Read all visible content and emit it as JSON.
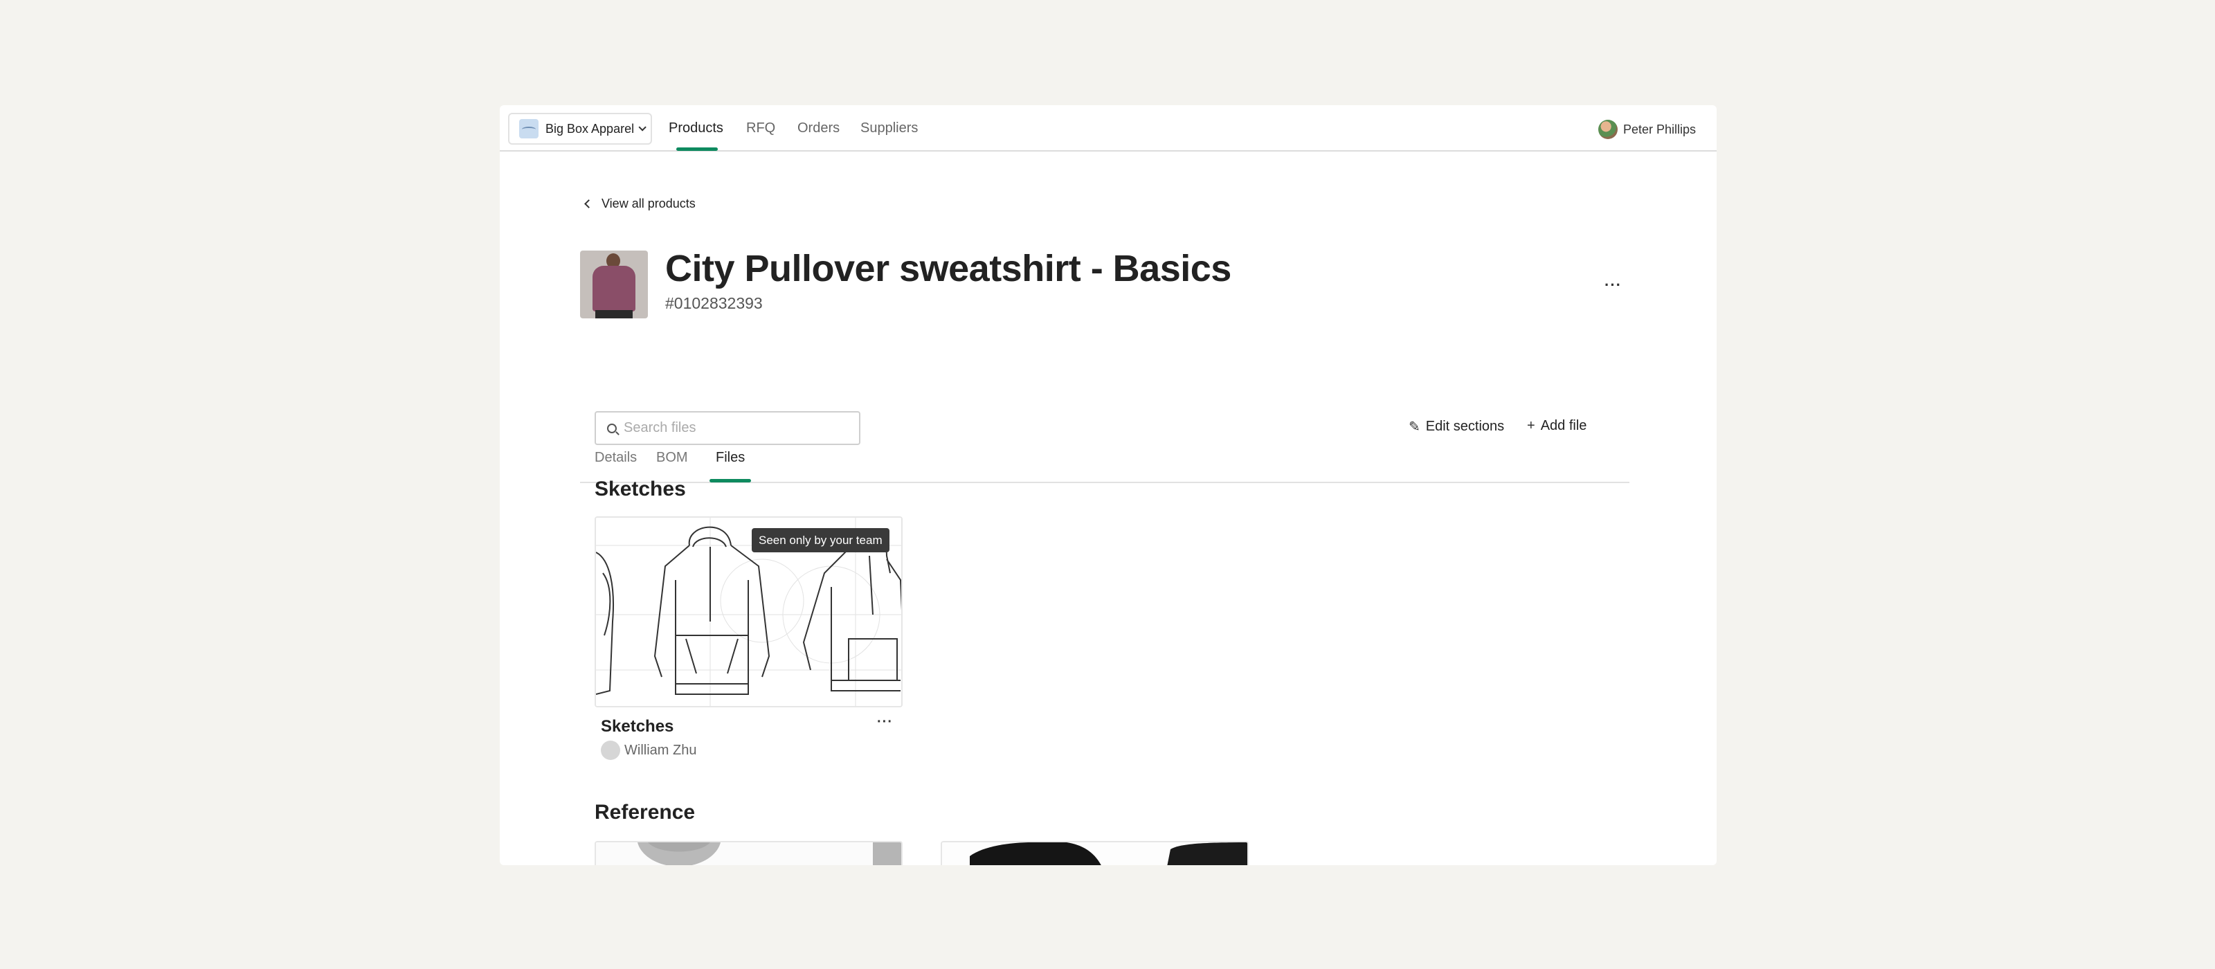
{
  "nav": {
    "org_name": "Big Box Apparel",
    "tabs": [
      {
        "label": "Products",
        "active": true
      },
      {
        "label": "RFQ",
        "active": false
      },
      {
        "label": "Orders",
        "active": false
      },
      {
        "label": "Suppliers",
        "active": false
      }
    ],
    "user_name": "Peter Phillips"
  },
  "breadcrumb": {
    "back_label": "View all products"
  },
  "product": {
    "title": "City Pullover sweatshirt - Basics",
    "sku": "#0102832393",
    "more_label": "···"
  },
  "tabs": [
    {
      "label": "Details",
      "active": false
    },
    {
      "label": "BOM",
      "active": false
    },
    {
      "label": "Files",
      "active": true
    }
  ],
  "toolbar": {
    "search_placeholder": "Search files",
    "search_value": "",
    "edit_sections_label": "Edit sections",
    "add_file_label": "Add file"
  },
  "sections": [
    {
      "title": "Sketches",
      "files": [
        {
          "name": "Sketches",
          "author": "William Zhu",
          "badge": "Seen only by your team",
          "more_label": "···"
        }
      ]
    },
    {
      "title": "Reference",
      "files": [
        {
          "name": "",
          "author": ""
        },
        {
          "name": "",
          "author": ""
        }
      ]
    }
  ],
  "colors": {
    "accent": "#0e8a5f",
    "background": "#f4f3ef",
    "tooltip": "#3a3a3a"
  },
  "icons": [
    "chevron-down-icon",
    "chevron-left-icon",
    "search-icon",
    "pencil-icon",
    "plus-icon",
    "more-icon"
  ]
}
